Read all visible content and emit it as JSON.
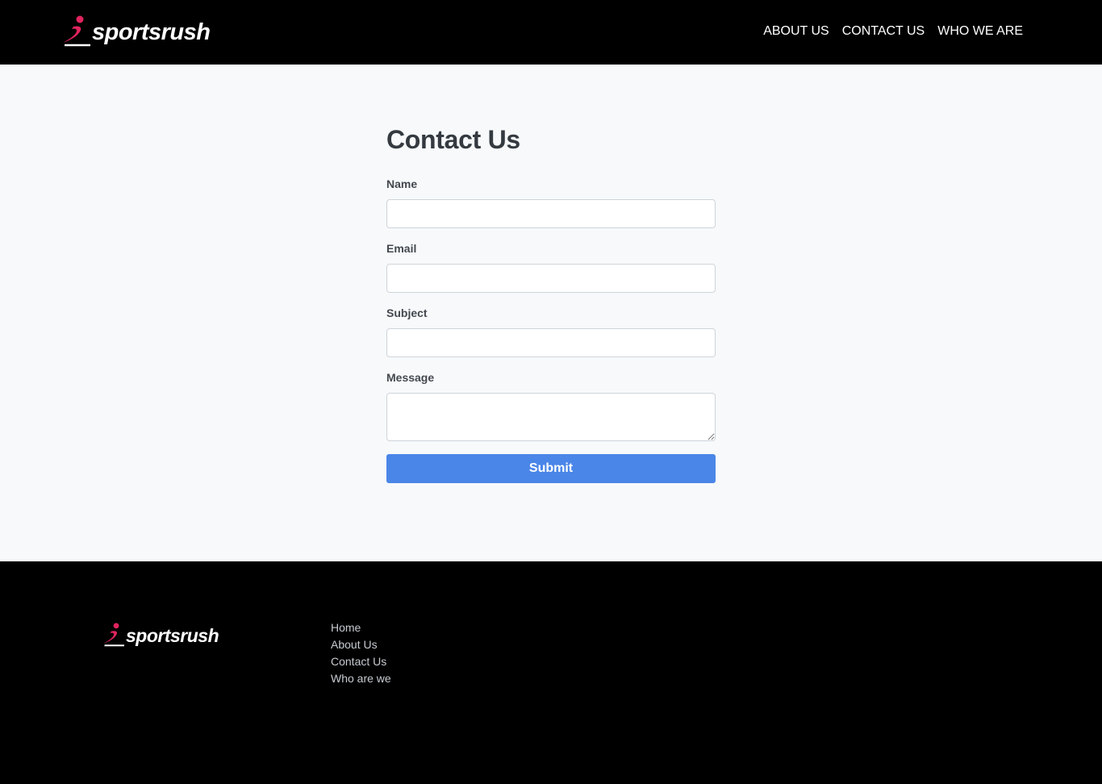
{
  "brand": {
    "name": "sportsrush",
    "accent": "#e0245e"
  },
  "nav": {
    "items": [
      "ABOUT US",
      "CONTACT US",
      "WHO WE ARE"
    ]
  },
  "contact_form": {
    "title": "Contact Us",
    "fields": {
      "name": {
        "label": "Name",
        "value": "",
        "placeholder": ""
      },
      "email": {
        "label": "Email",
        "value": "",
        "placeholder": ""
      },
      "subject": {
        "label": "Subject",
        "value": "",
        "placeholder": ""
      },
      "message": {
        "label": "Message",
        "value": "",
        "placeholder": ""
      }
    },
    "submit_label": "Submit",
    "submit_color": "#4a86e8"
  },
  "footer": {
    "links": [
      "Home",
      "About Us",
      "Contact Us",
      "Who are we"
    ]
  }
}
